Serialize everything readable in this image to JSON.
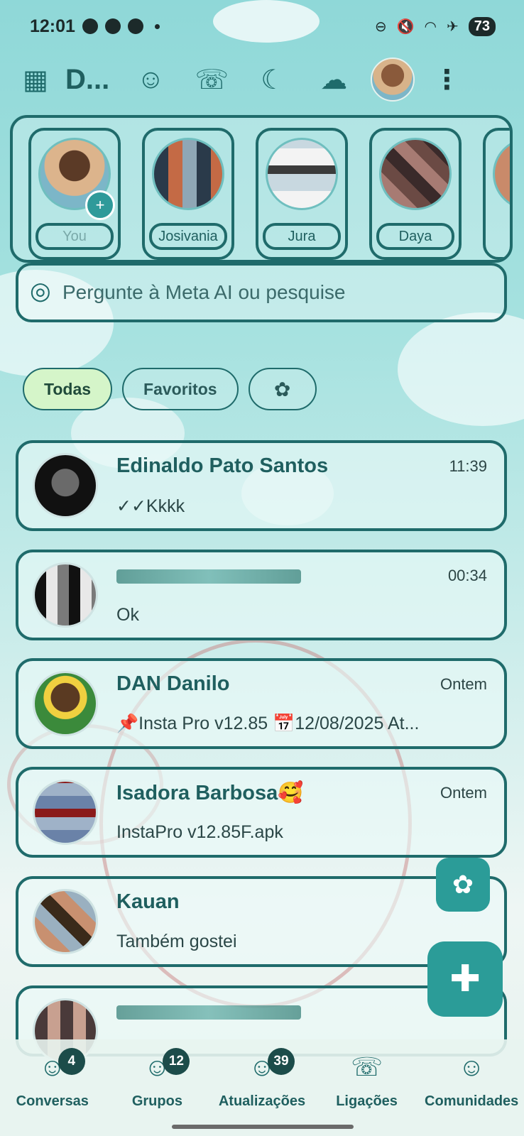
{
  "status_bar": {
    "time": "12:01",
    "battery": "73"
  },
  "app_bar": {
    "title": "D..."
  },
  "stories": [
    {
      "label": "You",
      "muted": true
    },
    {
      "label": "Josivania"
    },
    {
      "label": "Jura"
    },
    {
      "label": "Daya"
    }
  ],
  "search": {
    "placeholder": "Pergunte à Meta AI ou pesquise"
  },
  "filters": [
    {
      "label": "Todas",
      "active": true
    },
    {
      "label": "Favoritos",
      "active": false
    }
  ],
  "chats": [
    {
      "name": "Edinaldo Pato Santos",
      "time": "11:39",
      "message": "✓✓Kkkk"
    },
    {
      "name": "",
      "time": "00:34",
      "message": "Ok"
    },
    {
      "name": "DAN Danilo",
      "time": "Ontem",
      "message": "📌Insta Pro v12.85 📅12/08/2025  At..."
    },
    {
      "name": "Isadora Barbosa🥰",
      "time": "Ontem",
      "message": "InstaPro v12.85F.apk"
    },
    {
      "name": "Kauan",
      "time": "",
      "message": "Também gostei"
    }
  ],
  "bottom_nav": [
    {
      "label": "Conversas",
      "badge": "4"
    },
    {
      "label": "Grupos",
      "badge": "12"
    },
    {
      "label": "Atualizações",
      "badge": "39"
    },
    {
      "label": "Ligações",
      "badge": ""
    },
    {
      "label": "Comunidades",
      "badge": ""
    }
  ]
}
